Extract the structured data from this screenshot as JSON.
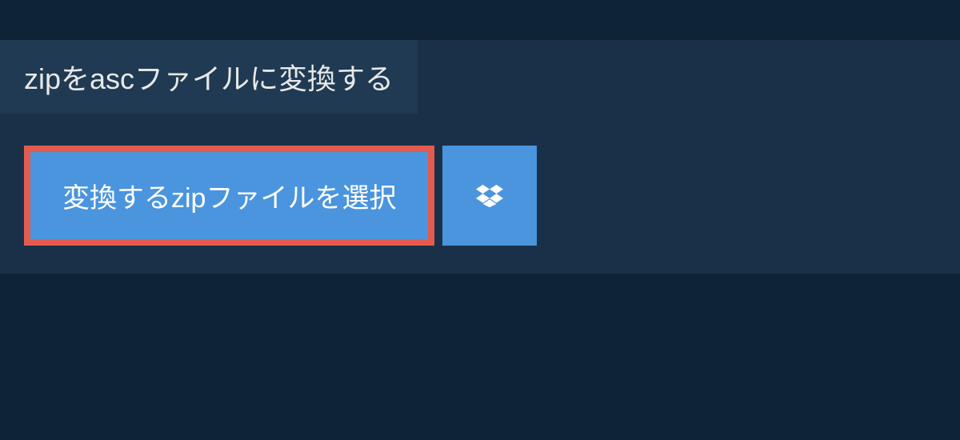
{
  "header": {
    "title": "zipをascファイルに変換する"
  },
  "actions": {
    "select_file_label": "変換するzipファイルを選択"
  },
  "colors": {
    "bg_outer": "#0f2337",
    "bg_panel": "#1a3049",
    "bg_title": "#1f3a52",
    "button_primary": "#4a95dd",
    "button_border_highlight": "#e35b4f",
    "text_light": "#e8e8e8",
    "text_white": "#ffffff"
  }
}
